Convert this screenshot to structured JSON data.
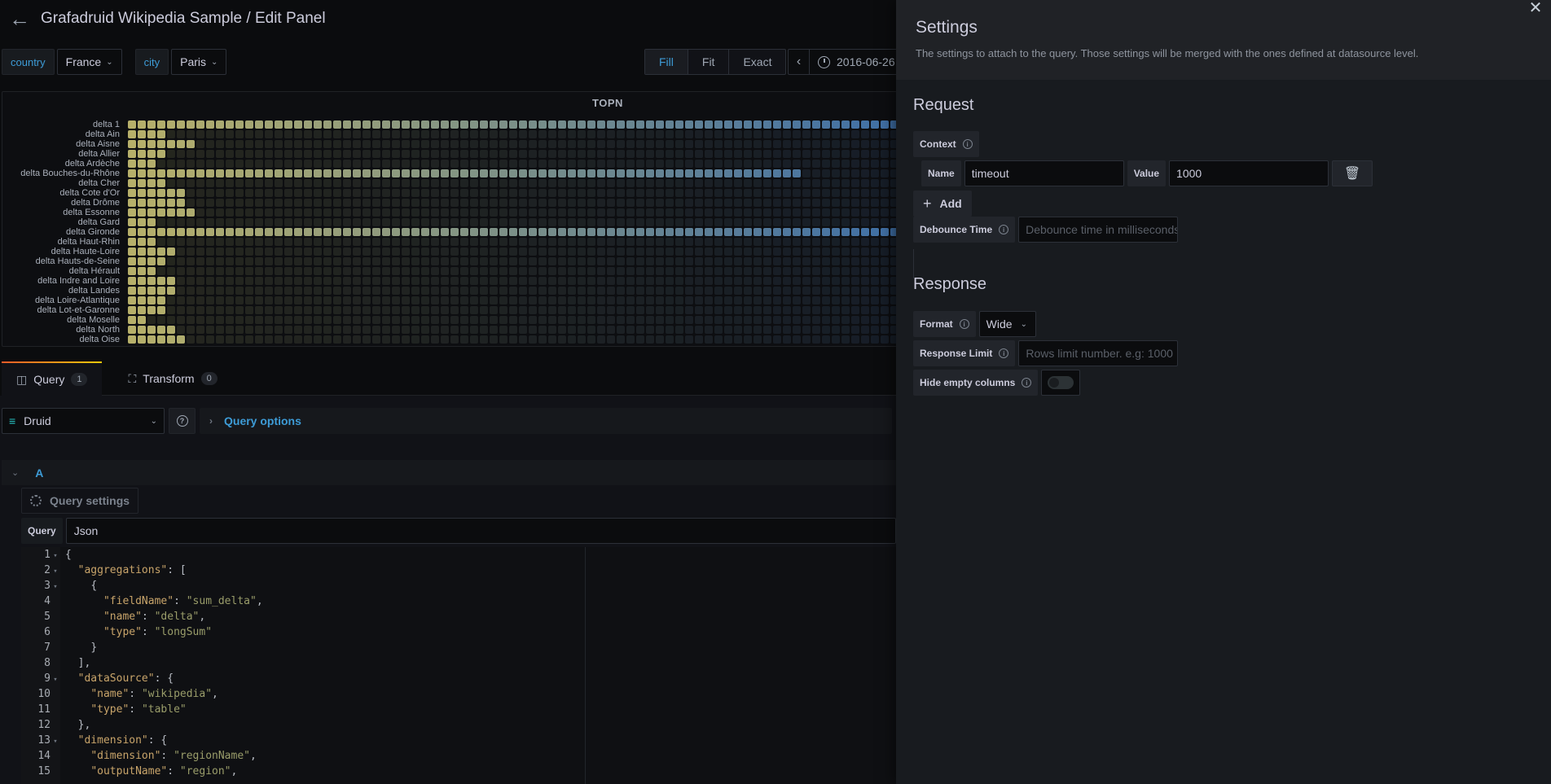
{
  "header": {
    "title": "Grafadruid Wikipedia Sample / Edit Panel",
    "back_icon": "arrow-left-icon"
  },
  "variables": [
    {
      "label": "country",
      "value": "France"
    },
    {
      "label": "city",
      "value": "Paris"
    }
  ],
  "toolbar": {
    "fit_modes": [
      "Fill",
      "Fit",
      "Exact"
    ],
    "selected_fit_mode": "Fill",
    "time_range": "2016-06-26"
  },
  "panel": {
    "title": "TOPN"
  },
  "chart_data": {
    "type": "heatmap",
    "title": "TOPN",
    "rows": [
      "delta 1",
      "delta Ain",
      "delta Aisne",
      "delta Allier",
      "delta Ardèche",
      "delta Bouches-du-Rhône",
      "delta Cher",
      "delta Cote d'Or",
      "delta Drôme",
      "delta Essonne",
      "delta Gard",
      "delta Gironde",
      "delta Haut-Rhin",
      "delta Haute-Loire",
      "delta Hauts-de-Seine",
      "delta Hérault",
      "delta Indre and Loire",
      "delta Landes",
      "delta Loire-Atlantique",
      "delta Lot-et-Garonne",
      "delta Moselle",
      "delta North",
      "delta Oise"
    ],
    "filled_counts": [
      79,
      4,
      7,
      4,
      3,
      69,
      4,
      6,
      6,
      7,
      3,
      79,
      3,
      5,
      4,
      3,
      5,
      5,
      4,
      4,
      2,
      5,
      6
    ],
    "columns_visible": 79,
    "color_scale": {
      "start": "#b7b06a",
      "end": "#3f6fa6",
      "empty_start": "#25261e",
      "empty_end": "#161d27"
    }
  },
  "tabs": [
    {
      "label": "Query",
      "count": "1",
      "icon": "database-icon",
      "active": true
    },
    {
      "label": "Transform",
      "count": "0",
      "icon": "transform-icon",
      "active": false
    }
  ],
  "datasource": {
    "name": "Druid",
    "query_options_label": "Query options"
  },
  "query": {
    "ref_id": "A",
    "settings_label": "Query settings",
    "query_label": "Query",
    "query_type": "Json",
    "code_lines": [
      {
        "n": "1",
        "fold": true,
        "indent": 0,
        "parts": [
          {
            "t": "p",
            "v": "{"
          }
        ]
      },
      {
        "n": "2",
        "fold": true,
        "indent": 1,
        "parts": [
          {
            "t": "k",
            "v": "\"aggregations\""
          },
          {
            "t": "p",
            "v": ": ["
          }
        ]
      },
      {
        "n": "3",
        "fold": true,
        "indent": 2,
        "parts": [
          {
            "t": "p",
            "v": "{"
          }
        ]
      },
      {
        "n": "4",
        "fold": false,
        "indent": 3,
        "parts": [
          {
            "t": "k",
            "v": "\"fieldName\""
          },
          {
            "t": "p",
            "v": ": "
          },
          {
            "t": "s",
            "v": "\"sum_delta\""
          },
          {
            "t": "p",
            "v": ","
          }
        ]
      },
      {
        "n": "5",
        "fold": false,
        "indent": 3,
        "parts": [
          {
            "t": "k",
            "v": "\"name\""
          },
          {
            "t": "p",
            "v": ": "
          },
          {
            "t": "s",
            "v": "\"delta\""
          },
          {
            "t": "p",
            "v": ","
          }
        ]
      },
      {
        "n": "6",
        "fold": false,
        "indent": 3,
        "parts": [
          {
            "t": "k",
            "v": "\"type\""
          },
          {
            "t": "p",
            "v": ": "
          },
          {
            "t": "s",
            "v": "\"longSum\""
          }
        ]
      },
      {
        "n": "7",
        "fold": false,
        "indent": 2,
        "parts": [
          {
            "t": "p",
            "v": "}"
          }
        ]
      },
      {
        "n": "8",
        "fold": false,
        "indent": 1,
        "parts": [
          {
            "t": "p",
            "v": "],"
          }
        ]
      },
      {
        "n": "9",
        "fold": true,
        "indent": 1,
        "parts": [
          {
            "t": "k",
            "v": "\"dataSource\""
          },
          {
            "t": "p",
            "v": ": {"
          }
        ]
      },
      {
        "n": "10",
        "fold": false,
        "indent": 2,
        "parts": [
          {
            "t": "k",
            "v": "\"name\""
          },
          {
            "t": "p",
            "v": ": "
          },
          {
            "t": "s",
            "v": "\"wikipedia\""
          },
          {
            "t": "p",
            "v": ","
          }
        ]
      },
      {
        "n": "11",
        "fold": false,
        "indent": 2,
        "parts": [
          {
            "t": "k",
            "v": "\"type\""
          },
          {
            "t": "p",
            "v": ": "
          },
          {
            "t": "s",
            "v": "\"table\""
          }
        ]
      },
      {
        "n": "12",
        "fold": false,
        "indent": 1,
        "parts": [
          {
            "t": "p",
            "v": "},"
          }
        ]
      },
      {
        "n": "13",
        "fold": true,
        "indent": 1,
        "parts": [
          {
            "t": "k",
            "v": "\"dimension\""
          },
          {
            "t": "p",
            "v": ": {"
          }
        ]
      },
      {
        "n": "14",
        "fold": false,
        "indent": 2,
        "parts": [
          {
            "t": "k",
            "v": "\"dimension\""
          },
          {
            "t": "p",
            "v": ": "
          },
          {
            "t": "s",
            "v": "\"regionName\""
          },
          {
            "t": "p",
            "v": ","
          }
        ]
      },
      {
        "n": "15",
        "fold": false,
        "indent": 2,
        "parts": [
          {
            "t": "k",
            "v": "\"outputName\""
          },
          {
            "t": "p",
            "v": ": "
          },
          {
            "t": "s",
            "v": "\"region\""
          },
          {
            "t": "p",
            "v": ","
          }
        ]
      }
    ]
  },
  "drawer": {
    "title": "Settings",
    "subtitle": "The settings to attach to the query. Those settings will be merged with the ones defined at datasource level.",
    "request": {
      "title": "Request",
      "context_label": "Context",
      "context_entries": [
        {
          "name_label": "Name",
          "name": "timeout",
          "value_label": "Value",
          "value": "1000"
        }
      ],
      "add_label": "Add",
      "debounce_label": "Debounce Time",
      "debounce_placeholder": "Debounce time in milliseconds",
      "debounce_value": ""
    },
    "response": {
      "title": "Response",
      "format_label": "Format",
      "format_value": "Wide",
      "limit_label": "Response Limit",
      "limit_placeholder": "Rows limit number. e.g: 1000",
      "hide_empty_label": "Hide empty columns",
      "hide_empty_value": false
    }
  }
}
